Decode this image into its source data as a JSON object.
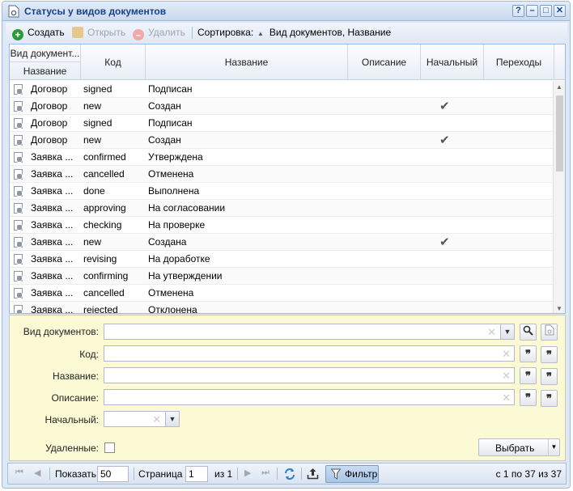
{
  "window": {
    "title": "Статусы у видов документов",
    "controls": [
      "?",
      "–",
      "□",
      "✕"
    ]
  },
  "toolbar": {
    "create": "Создать",
    "open": "Открыть",
    "delete": "Удалить",
    "sort_label": "Сортировка:",
    "sort_value": "Вид документов, Название"
  },
  "grid": {
    "headers": {
      "doc_type": "Вид документ...",
      "doc_type_sub": "Название",
      "code": "Код",
      "name": "Название",
      "description": "Описание",
      "initial": "Начальный",
      "transitions": "Переходы"
    },
    "rows": [
      {
        "doc": "Договор",
        "code": "signed",
        "name": "Подписан",
        "initial": ""
      },
      {
        "doc": "Договор",
        "code": "new",
        "name": "Создан",
        "initial": "✔"
      },
      {
        "doc": "Договор",
        "code": "signed",
        "name": "Подписан",
        "initial": ""
      },
      {
        "doc": "Договор",
        "code": "new",
        "name": "Создан",
        "initial": "✔"
      },
      {
        "doc": "Заявка ...",
        "code": "confirmed",
        "name": "Утверждена",
        "initial": ""
      },
      {
        "doc": "Заявка ...",
        "code": "cancelled",
        "name": "Отменена",
        "initial": ""
      },
      {
        "doc": "Заявка ...",
        "code": "done",
        "name": "Выполнена",
        "initial": ""
      },
      {
        "doc": "Заявка ...",
        "code": "approving",
        "name": "На согласовании",
        "initial": ""
      },
      {
        "doc": "Заявка ...",
        "code": "checking",
        "name": "На проверке",
        "initial": ""
      },
      {
        "doc": "Заявка ...",
        "code": "new",
        "name": "Создана",
        "initial": "✔"
      },
      {
        "doc": "Заявка ...",
        "code": "revising",
        "name": "На доработке",
        "initial": ""
      },
      {
        "doc": "Заявка ...",
        "code": "confirming",
        "name": "На утверждении",
        "initial": ""
      },
      {
        "doc": "Заявка ...",
        "code": "cancelled",
        "name": "Отменена",
        "initial": ""
      },
      {
        "doc": "Заявка ...",
        "code": "rejected",
        "name": "Отклонена",
        "initial": ""
      }
    ]
  },
  "filter": {
    "doc_type_label": "Вид документов:",
    "code_label": "Код:",
    "name_label": "Название:",
    "description_label": "Описание:",
    "initial_label": "Начальный:",
    "deleted_label": "Удаленные:",
    "select_button": "Выбрать",
    "quote_glyph": "❞"
  },
  "pager": {
    "show_label": "Показать",
    "page_size": "50",
    "page_label": "Страница",
    "page": "1",
    "of_label": "из 1",
    "filter_button": "Фильтр",
    "summary": "с 1 по 37 из 37"
  }
}
